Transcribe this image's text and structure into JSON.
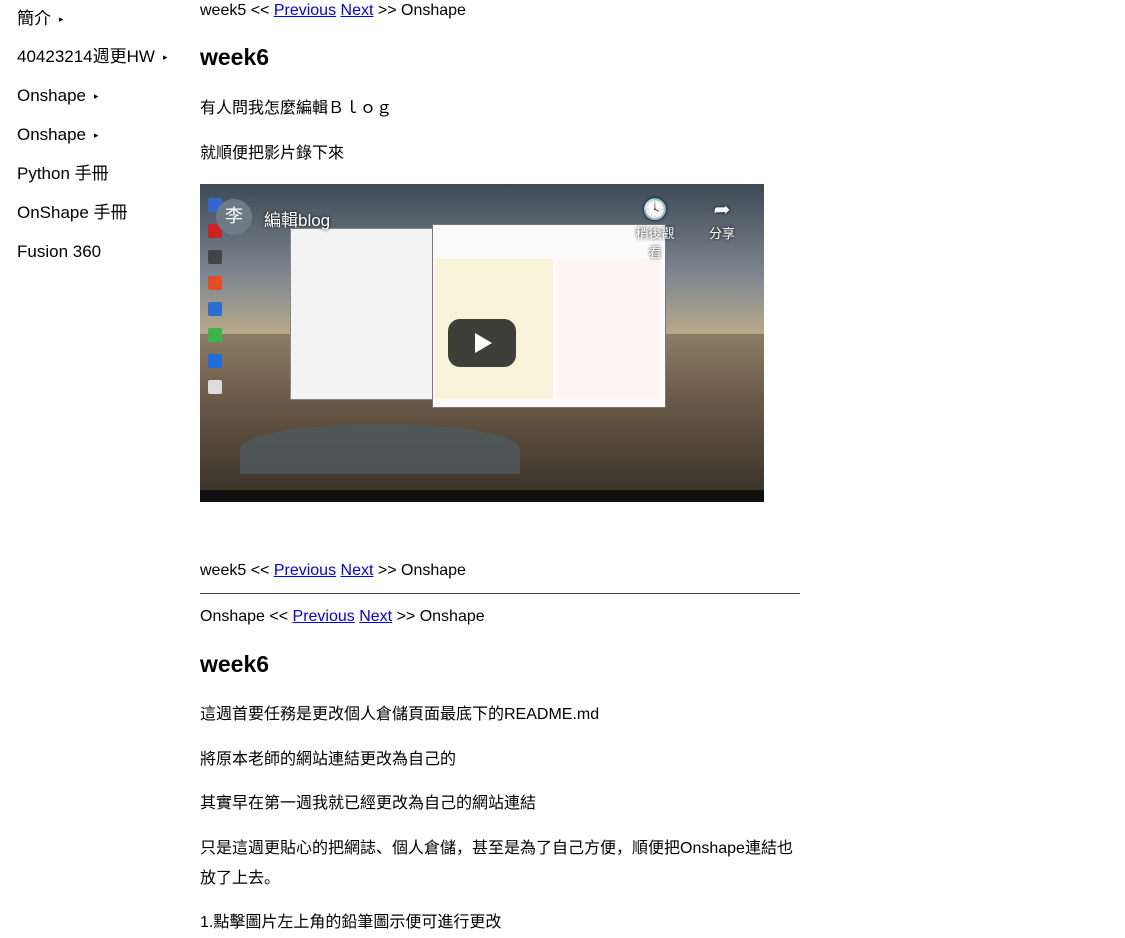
{
  "sidebar": {
    "items": [
      {
        "label": "簡介",
        "arrow": "▸"
      },
      {
        "label": "40423214週更HW",
        "arrow": "▸"
      },
      {
        "label": "Onshape",
        "arrow": "▸"
      },
      {
        "label": "Onshape",
        "arrow": "▸"
      },
      {
        "label": "Python 手冊",
        "arrow": ""
      },
      {
        "label": "OnShape 手冊",
        "arrow": ""
      },
      {
        "label": "Fusion 360",
        "arrow": ""
      }
    ]
  },
  "nav1": {
    "before": "week5 << ",
    "prev": "Previous",
    "space": " ",
    "next": "Next",
    "after": " >> Onshape"
  },
  "post1": {
    "title": "week6",
    "p1": "有人問我怎麼編輯Ｂｌｏｇ",
    "p2": "就順便把影片錄下來",
    "video": {
      "avatar": "李",
      "title": "編輯blog",
      "watch_later": "稍後觀看",
      "share": "分享",
      "watch_icon": "clock-icon",
      "share_icon": "share-arrow-icon"
    }
  },
  "nav2": {
    "before": "week5 << ",
    "prev": "Previous",
    "space": " ",
    "next": "Next",
    "after": " >> Onshape"
  },
  "nav3": {
    "before": "Onshape << ",
    "prev": "Previous",
    "space": " ",
    "next": "Next",
    "after": " >> Onshape"
  },
  "post2": {
    "title": "week6",
    "p1": "這週首要任務是更改個人倉儲頁面最底下的README.md",
    "p2": "將原本老師的網站連結更改為自己的",
    "p3": "其實早在第一週我就已經更改為自己的網站連結",
    "p4": "只是這週更貼心的把網誌、個人倉儲，甚至是為了自己方便，順便把Onshape連結也放了上去。",
    "p5": "1.點擊圖片左上角的鉛筆圖示便可進行更改"
  }
}
